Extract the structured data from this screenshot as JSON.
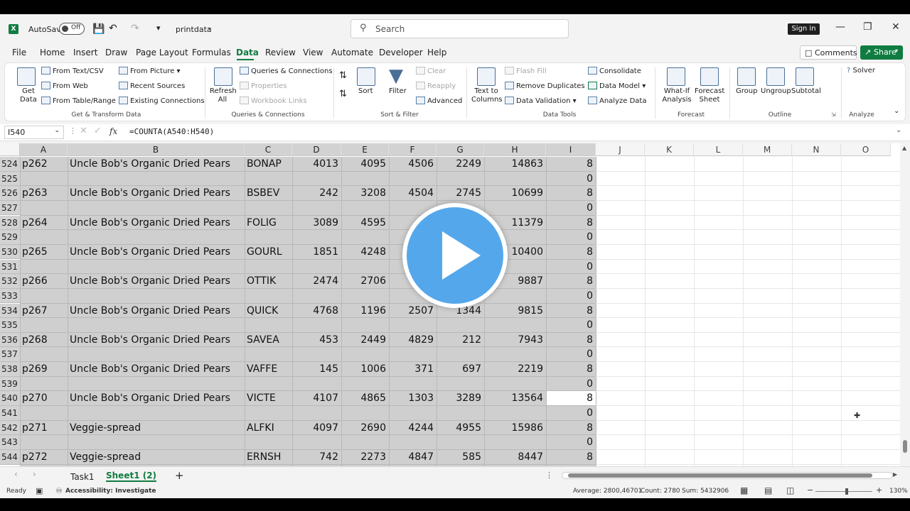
{
  "titlebar": {
    "autosave_label": "AutoSave",
    "autosave_state": "Off",
    "file_name": "printdata",
    "search_placeholder": "Search",
    "signin_label": "Sign in"
  },
  "menu": {
    "tabs": [
      "File",
      "Home",
      "Insert",
      "Draw",
      "Page Layout",
      "Formulas",
      "Data",
      "Review",
      "View",
      "Automate",
      "Developer",
      "Help"
    ],
    "active": "Data",
    "comments_label": "Comments",
    "share_label": "Share"
  },
  "ribbon": {
    "get_data": "Get Data",
    "from_text_csv": "From Text/CSV",
    "from_web": "From Web",
    "from_table_range": "From Table/Range",
    "from_picture": "From Picture",
    "recent_sources": "Recent Sources",
    "existing_connections": "Existing Connections",
    "group_get_transform": "Get & Transform Data",
    "refresh_all": "Refresh All",
    "queries_connections": "Queries & Connections",
    "properties": "Properties",
    "workbook_links": "Workbook Links",
    "group_queries": "Queries & Connections",
    "sort": "Sort",
    "filter": "Filter",
    "clear": "Clear",
    "reapply": "Reapply",
    "advanced": "Advanced",
    "group_sort_filter": "Sort & Filter",
    "text_to_columns": "Text to Columns",
    "flash_fill": "Flash Fill",
    "remove_duplicates": "Remove Duplicates",
    "data_validation": "Data Validation",
    "consolidate": "Consolidate",
    "data_model": "Data Model",
    "analyze_data": "Analyze Data",
    "group_data_tools": "Data Tools",
    "what_if": "What-If Analysis",
    "forecast_sheet": "Forecast Sheet",
    "group_forecast": "Forecast",
    "group": "Group",
    "ungroup": "Ungroup",
    "subtotal": "Subtotal",
    "group_outline": "Outline",
    "solver": "Solver",
    "group_analyze": "Analyze"
  },
  "formula_bar": {
    "name_box": "I540",
    "fx": "fx",
    "formula": "=COUNTA(A540:H540)"
  },
  "columns": [
    "A",
    "B",
    "C",
    "D",
    "E",
    "F",
    "G",
    "H",
    "I",
    "J",
    "K",
    "L",
    "M",
    "N",
    "O"
  ],
  "rows": [
    {
      "n": "524",
      "a": "p262",
      "b": "Uncle Bob's Organic Dried Pears",
      "c": "BONAP",
      "d": "4013",
      "e": "4095",
      "f": "4506",
      "g": "2249",
      "h": "14863",
      "i": "8"
    },
    {
      "n": "525",
      "a": "",
      "b": "",
      "c": "",
      "d": "",
      "e": "",
      "f": "",
      "g": "",
      "h": "",
      "i": "0"
    },
    {
      "n": "526",
      "a": "p263",
      "b": "Uncle Bob's Organic Dried Pears",
      "c": "BSBEV",
      "d": "242",
      "e": "3208",
      "f": "4504",
      "g": "2745",
      "h": "10699",
      "i": "8"
    },
    {
      "n": "527",
      "a": "",
      "b": "",
      "c": "",
      "d": "",
      "e": "",
      "f": "",
      "g": "",
      "h": "",
      "i": "0"
    },
    {
      "n": "528",
      "a": "p264",
      "b": "Uncle Bob's Organic Dried Pears",
      "c": "FOLIG",
      "d": "3089",
      "e": "4595",
      "f": "",
      "g": "",
      "h": "11379",
      "i": "8"
    },
    {
      "n": "529",
      "a": "",
      "b": "",
      "c": "",
      "d": "",
      "e": "",
      "f": "",
      "g": "",
      "h": "",
      "i": "0"
    },
    {
      "n": "530",
      "a": "p265",
      "b": "Uncle Bob's Organic Dried Pears",
      "c": "GOURL",
      "d": "1851",
      "e": "4248",
      "f": "",
      "g": "",
      "h": "10400",
      "i": "8"
    },
    {
      "n": "531",
      "a": "",
      "b": "",
      "c": "",
      "d": "",
      "e": "",
      "f": "",
      "g": "",
      "h": "",
      "i": "0"
    },
    {
      "n": "532",
      "a": "p266",
      "b": "Uncle Bob's Organic Dried Pears",
      "c": "OTTIK",
      "d": "2474",
      "e": "2706",
      "f": "",
      "g": "",
      "h": "9887",
      "i": "8"
    },
    {
      "n": "533",
      "a": "",
      "b": "",
      "c": "",
      "d": "",
      "e": "",
      "f": "",
      "g": "",
      "h": "",
      "i": "0"
    },
    {
      "n": "534",
      "a": "p267",
      "b": "Uncle Bob's Organic Dried Pears",
      "c": "QUICK",
      "d": "4768",
      "e": "1196",
      "f": "2507",
      "g": "1344",
      "h": "9815",
      "i": "8"
    },
    {
      "n": "535",
      "a": "",
      "b": "",
      "c": "",
      "d": "",
      "e": "",
      "f": "",
      "g": "",
      "h": "",
      "i": "0"
    },
    {
      "n": "536",
      "a": "p268",
      "b": "Uncle Bob's Organic Dried Pears",
      "c": "SAVEA",
      "d": "453",
      "e": "2449",
      "f": "4829",
      "g": "212",
      "h": "7943",
      "i": "8"
    },
    {
      "n": "537",
      "a": "",
      "b": "",
      "c": "",
      "d": "",
      "e": "",
      "f": "",
      "g": "",
      "h": "",
      "i": "0"
    },
    {
      "n": "538",
      "a": "p269",
      "b": "Uncle Bob's Organic Dried Pears",
      "c": "VAFFE",
      "d": "145",
      "e": "1006",
      "f": "371",
      "g": "697",
      "h": "2219",
      "i": "8"
    },
    {
      "n": "539",
      "a": "",
      "b": "",
      "c": "",
      "d": "",
      "e": "",
      "f": "",
      "g": "",
      "h": "",
      "i": "0"
    },
    {
      "n": "540",
      "a": "p270",
      "b": "Uncle Bob's Organic Dried Pears",
      "c": "VICTE",
      "d": "4107",
      "e": "4865",
      "f": "1303",
      "g": "3289",
      "h": "13564",
      "i": "8"
    },
    {
      "n": "541",
      "a": "",
      "b": "",
      "c": "",
      "d": "",
      "e": "",
      "f": "",
      "g": "",
      "h": "",
      "i": "0"
    },
    {
      "n": "542",
      "a": "p271",
      "b": "Veggie-spread",
      "c": "ALFKI",
      "d": "4097",
      "e": "2690",
      "f": "4244",
      "g": "4955",
      "h": "15986",
      "i": "8"
    },
    {
      "n": "543",
      "a": "",
      "b": "",
      "c": "",
      "d": "",
      "e": "",
      "f": "",
      "g": "",
      "h": "",
      "i": "0"
    },
    {
      "n": "544",
      "a": "p272",
      "b": "Veggie-spread",
      "c": "ERNSH",
      "d": "742",
      "e": "2273",
      "f": "4847",
      "g": "585",
      "h": "8447",
      "i": "8"
    }
  ],
  "sheets": {
    "tabs": [
      "Task1",
      "Sheet1 (2)"
    ],
    "active": "Sheet1 (2)",
    "add": "+"
  },
  "status": {
    "ready": "Ready",
    "accessibility": "Accessibility: Investigate",
    "average": "Average: 2800,46701",
    "count": "Count: 2780",
    "sum": "Sum: 5432906",
    "zoom": "130%"
  },
  "colors": {
    "accent": "#107c41",
    "selection": "#cfcfcf",
    "play": "#55a7eb"
  }
}
